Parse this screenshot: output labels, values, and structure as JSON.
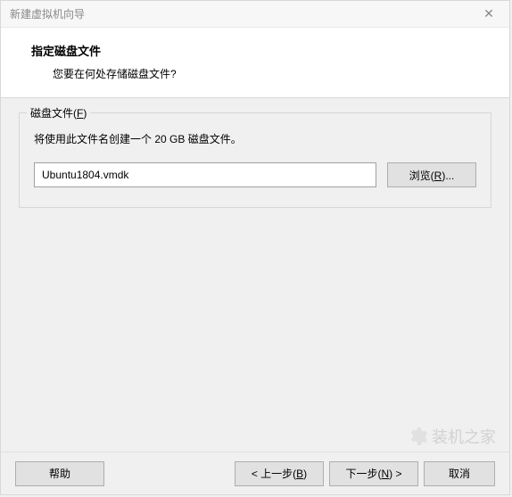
{
  "titlebar": {
    "title": "新建虚拟机向导"
  },
  "header": {
    "title": "指定磁盘文件",
    "subtitle": "您要在何处存储磁盘文件?"
  },
  "fieldset": {
    "legend_prefix": "磁盘文件(",
    "legend_key": "F",
    "legend_suffix": ")",
    "description": "将使用此文件名创建一个 20 GB 磁盘文件。",
    "input_value": "Ubuntu1804.vmdk",
    "browse_prefix": "浏览(",
    "browse_key": "R",
    "browse_suffix": ")..."
  },
  "footer": {
    "help": "帮助",
    "back_prefix": "< 上一步(",
    "back_key": "B",
    "back_suffix": ")",
    "next_prefix": "下一步(",
    "next_key": "N",
    "next_suffix": ") >",
    "cancel": "取消"
  },
  "watermark": {
    "text": "装机之家"
  }
}
